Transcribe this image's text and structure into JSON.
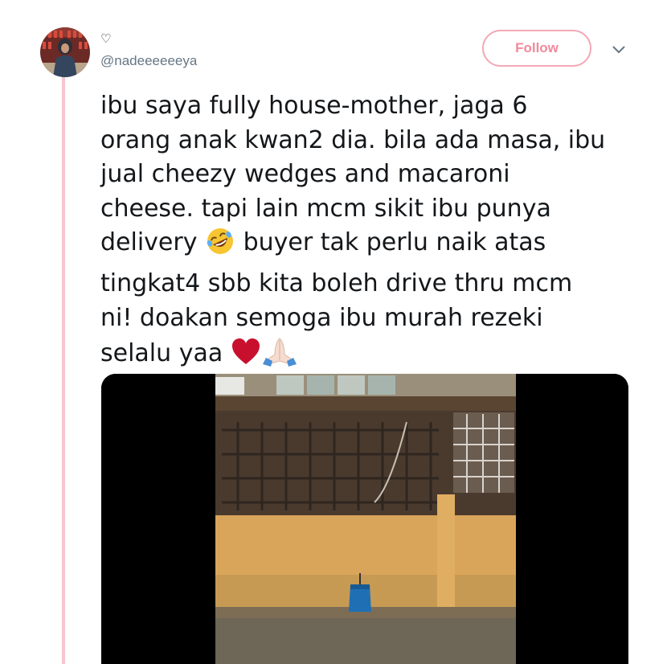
{
  "tweet": {
    "display_name": "♡",
    "handle": "@nadeeeeeeya",
    "follow_label": "Follow",
    "text_lines": [
      "ibu saya fully house-mother, jaga 6",
      "orang anak kwan2 dia. bila ada masa, ibu",
      "jual cheezy wedges and macaroni",
      "cheese. tapi lain mcm sikit ibu punya",
      "delivery",
      "buyer tak perlu naik atas",
      "tingkat4 sbb kita boleh drive thru mcm",
      "ni! doakan semoga ibu murah rezeki",
      "selalu yaa"
    ],
    "icons": {
      "caret": "chevron-down-icon",
      "emoji_1": "rolling-on-floor-laughing-emoji",
      "emoji_2": "red-heart-emoji",
      "emoji_3": "folded-hands-emoji"
    },
    "media": {
      "type": "video",
      "description_visible": false
    }
  },
  "colors": {
    "thread_line": "#f4c6d0",
    "follow_border": "#f3a9b7",
    "follow_text": "#f08a9b",
    "handle": "#657786",
    "text": "#14171a",
    "heart": "#c8102e"
  }
}
